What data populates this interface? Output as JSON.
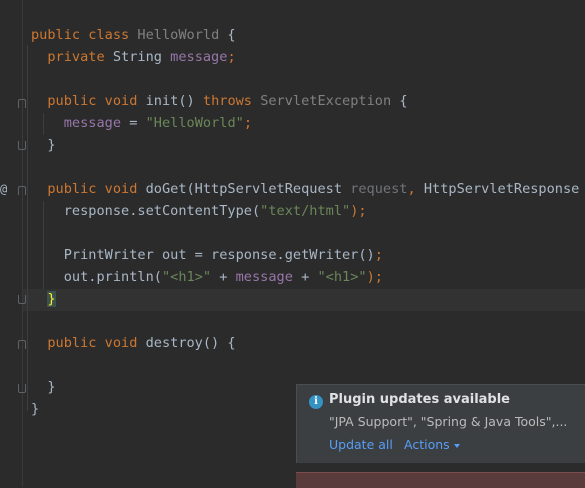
{
  "editor": {
    "lines": [
      {
        "id": "l1",
        "tokens": [
          {
            "t": "public class ",
            "c": "kw"
          },
          {
            "t": "HelloWorld",
            "c": "typ-dim"
          },
          {
            "t": " {",
            "c": ""
          }
        ]
      },
      {
        "id": "l2",
        "tokens": [
          {
            "t": "  private ",
            "c": "kw"
          },
          {
            "t": "String ",
            "c": ""
          },
          {
            "t": "message",
            "c": "fld"
          },
          {
            "t": ";",
            "c": "kw"
          }
        ]
      },
      {
        "id": "l3",
        "tokens": []
      },
      {
        "id": "l4",
        "tokens": [
          {
            "t": "  public void ",
            "c": "kw"
          },
          {
            "t": "init",
            "c": ""
          },
          {
            "t": "() ",
            "c": ""
          },
          {
            "t": "throws ",
            "c": "kw"
          },
          {
            "t": "ServletException",
            "c": "typ-dim"
          },
          {
            "t": " {",
            "c": ""
          }
        ]
      },
      {
        "id": "l5",
        "tokens": [
          {
            "t": "    ",
            "c": ""
          },
          {
            "t": "message",
            "c": "fld"
          },
          {
            "t": " = ",
            "c": ""
          },
          {
            "t": "\"HelloWorld\"",
            "c": "str"
          },
          {
            "t": ";",
            "c": "kw"
          }
        ]
      },
      {
        "id": "l6",
        "tokens": [
          {
            "t": "  }",
            "c": ""
          }
        ]
      },
      {
        "id": "l7",
        "tokens": []
      },
      {
        "id": "l8",
        "tokens": [
          {
            "t": "  public void ",
            "c": "kw"
          },
          {
            "t": "doGet",
            "c": ""
          },
          {
            "t": "(HttpServletRequest ",
            "c": ""
          },
          {
            "t": "request",
            "c": "par"
          },
          {
            "t": ", ",
            "c": "kw"
          },
          {
            "t": "HttpServletResponse re",
            "c": ""
          }
        ]
      },
      {
        "id": "l9",
        "tokens": [
          {
            "t": "    response.setContentType(",
            "c": ""
          },
          {
            "t": "\"text/html\"",
            "c": "str"
          },
          {
            "t": ");",
            "c": "kw"
          }
        ]
      },
      {
        "id": "l10",
        "tokens": []
      },
      {
        "id": "l11",
        "tokens": [
          {
            "t": "    PrintWriter out = response.getWriter()",
            "c": ""
          },
          {
            "t": ";",
            "c": "kw"
          }
        ]
      },
      {
        "id": "l12",
        "tokens": [
          {
            "t": "    out.println(",
            "c": ""
          },
          {
            "t": "\"<h1>\"",
            "c": "str"
          },
          {
            "t": " + ",
            "c": ""
          },
          {
            "t": "message",
            "c": "fld"
          },
          {
            "t": " + ",
            "c": ""
          },
          {
            "t": "\"<h1>\"",
            "c": "str"
          },
          {
            "t": ");",
            "c": "kw"
          }
        ]
      },
      {
        "id": "l13",
        "tokens": [
          {
            "t": "  ",
            "c": ""
          },
          {
            "t": "}",
            "c": "brace-hl"
          }
        ]
      },
      {
        "id": "l14",
        "tokens": []
      },
      {
        "id": "l15",
        "tokens": [
          {
            "t": "  public void ",
            "c": "kw"
          },
          {
            "t": "destroy",
            "c": ""
          },
          {
            "t": "() {",
            "c": ""
          }
        ]
      },
      {
        "id": "l16",
        "tokens": []
      },
      {
        "id": "l17",
        "tokens": [
          {
            "t": "  }",
            "c": ""
          }
        ]
      },
      {
        "id": "l18",
        "tokens": [
          {
            "t": "}",
            "c": ""
          }
        ]
      }
    ],
    "gutter_marker": "@",
    "icons": {
      "override_marker": "at-sign-icon"
    }
  },
  "notification": {
    "icon": "info-icon",
    "icon_glyph": "i",
    "title": "Plugin updates available",
    "body": "\"JPA Support\", \"Spring & Java Tools\",...",
    "update_link": "Update all",
    "actions_link": "Actions",
    "accent": "#589df6"
  }
}
